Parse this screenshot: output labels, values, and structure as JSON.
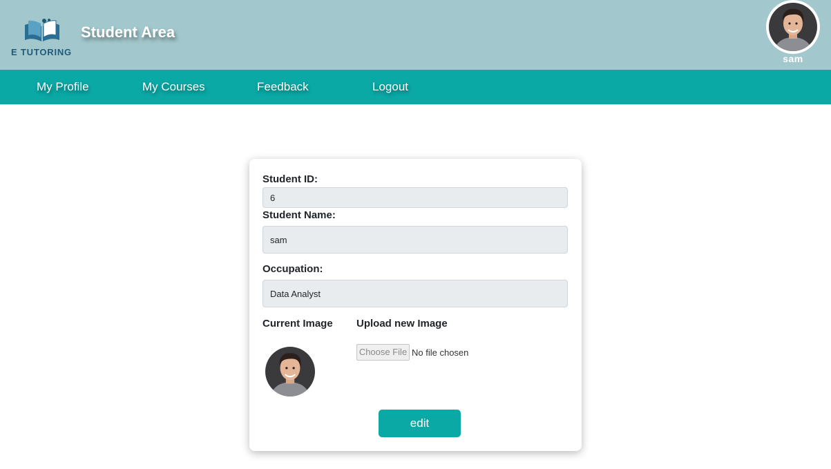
{
  "header": {
    "brand": "E TUTORING",
    "page_title": "Student Area",
    "user_name": "sam"
  },
  "nav": {
    "items": [
      {
        "label": "My Profile"
      },
      {
        "label": "My Courses"
      },
      {
        "label": "Feedback"
      },
      {
        "label": "Logout"
      }
    ]
  },
  "form": {
    "student_id_label": "Student ID:",
    "student_id_value": "6",
    "student_name_label": "Student Name:",
    "student_name_value": "sam",
    "occupation_label": "Occupation:",
    "occupation_value": "Data Analyst",
    "current_image_label": "Current Image",
    "upload_label": "Upload new Image",
    "choose_file_label": "Choose File",
    "file_status": "No file chosen",
    "edit_label": "edit"
  },
  "colors": {
    "header_bg": "#a2c8cd",
    "accent": "#0aa9a6",
    "brand_text": "#1f5a78",
    "field_bg": "#e9ecef"
  },
  "icons": {
    "logo": "open-book-icon",
    "avatar": "user-photo"
  }
}
